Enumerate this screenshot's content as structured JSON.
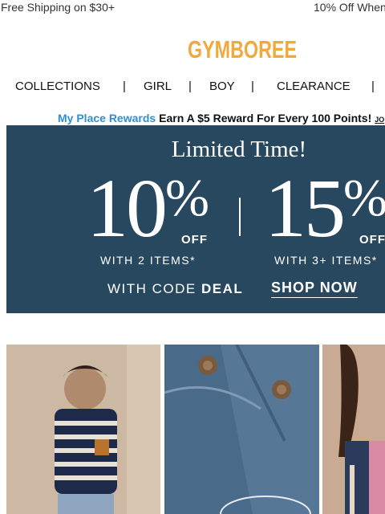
{
  "promo_bar": {
    "left": "Free Shipping on $30+",
    "right": "10% Off When"
  },
  "logo": {
    "text": "GYMBOREE",
    "color": "#f2a93b"
  },
  "nav": {
    "items": [
      {
        "label": "COLLECTIONS"
      },
      {
        "label": "GIRL"
      },
      {
        "label": "BOY"
      },
      {
        "label": "CLEARANCE"
      }
    ],
    "separator": "|"
  },
  "rewards": {
    "brand": "My Place Rewards",
    "message": "Earn A $5 Reward For Every 100 Points!",
    "link": "JO",
    "brand_color": "#2f8fd6"
  },
  "hero": {
    "headline": "Limited Time!",
    "offer1": {
      "value": "10",
      "unit": "%",
      "off": "OFF",
      "condition": "WITH 2 ITEMS*"
    },
    "offer2": {
      "value": "15",
      "unit": "%",
      "off": "OFF",
      "condition": "WITH 3+ ITEMS*"
    },
    "code_prefix": "WITH CODE",
    "code": "DEAL",
    "cta": "SHOP NOW",
    "background": "#284860"
  },
  "tiles": [
    {
      "name": "boy-striped-sweater-photo"
    },
    {
      "name": "denim-jeans-photo"
    },
    {
      "name": "girl-jacket-photo"
    }
  ]
}
